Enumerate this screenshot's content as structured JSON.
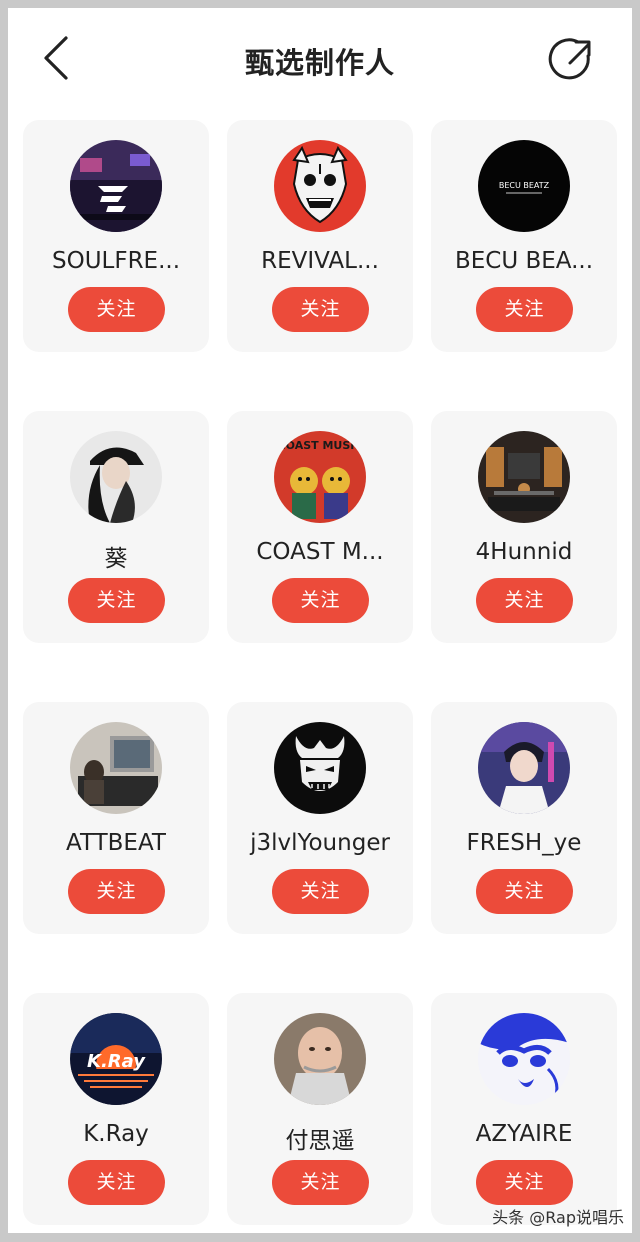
{
  "header": {
    "title": "甄选制作人"
  },
  "follow_label": "关注",
  "producers": [
    {
      "name": "SOULFRE..."
    },
    {
      "name": "REVIVAL..."
    },
    {
      "name": "BECU BEA..."
    },
    {
      "name": "葵"
    },
    {
      "name": "COAST M..."
    },
    {
      "name": "4Hunnid"
    },
    {
      "name": "ATTBEAT"
    },
    {
      "name": "j3lvlYounger"
    },
    {
      "name": "FRESH_ye"
    },
    {
      "name": "K.Ray"
    },
    {
      "name": "付思遥"
    },
    {
      "name": "AZYAIRE"
    }
  ],
  "avatar_texts": {
    "becu": "BECU BEATZ",
    "coast": "COAST MUSIC",
    "kray": "K.Ray"
  },
  "watermark": "头条 @Rap说唱乐",
  "colors": {
    "accent": "#ec4b3a",
    "card": "#f6f6f6"
  }
}
